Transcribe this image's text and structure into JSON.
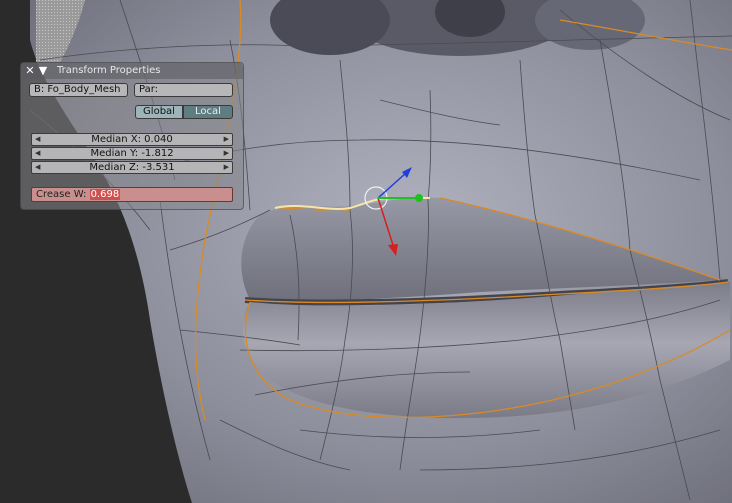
{
  "panel": {
    "title": "Transform Properties",
    "object_field": "B: Fo_Body_Mesh",
    "parent_field": "Par:",
    "toggle_global": "Global",
    "toggle_local": "Local",
    "active_toggle": "Local",
    "median_x": "Median X: 0.040",
    "median_y": "Median Y: -1.812",
    "median_z": "Median Z: -3.531",
    "crease_label": "Crease W:",
    "crease_value": "0.698",
    "close_icon": "close-icon",
    "collapse_icon": "triangle-down-icon"
  },
  "viewport": {
    "colors": {
      "mesh": "#8e8f9c",
      "edge": "#4a4a50",
      "seam": "#d98a25",
      "selected_edge": "#f2e0a0",
      "axis_x": "#d42020",
      "axis_y": "#20c020",
      "axis_z": "#2040d8"
    }
  }
}
